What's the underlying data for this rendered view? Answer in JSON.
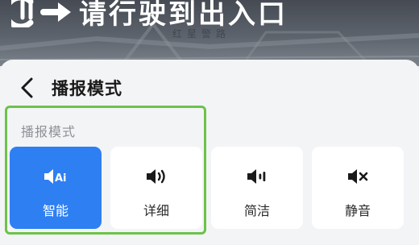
{
  "navigation": {
    "instruction": "请行驶到出入口",
    "road_name": "红星警路"
  },
  "sheet": {
    "title": "播报模式",
    "section_label": "播报模式",
    "options": [
      {
        "label": "智能",
        "icon": "speaker-ai-icon",
        "selected": true
      },
      {
        "label": "详细",
        "icon": "speaker-loud-icon",
        "selected": false
      },
      {
        "label": "简洁",
        "icon": "speaker-low-icon",
        "selected": false
      },
      {
        "label": "静音",
        "icon": "speaker-mute-icon",
        "selected": false
      }
    ]
  },
  "colors": {
    "accent": "#2e7ff2",
    "highlight": "#6cc24a",
    "sheet_bg": "#f3f4f6",
    "card_bg": "#ffffff"
  }
}
